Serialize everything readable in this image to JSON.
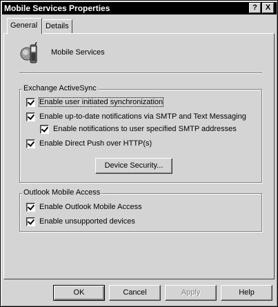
{
  "window": {
    "title": "Mobile Services Properties"
  },
  "titlebar_buttons": {
    "help": "?",
    "close": "X"
  },
  "tabs": [
    {
      "label": "General",
      "active": true
    },
    {
      "label": "Details",
      "active": false
    }
  ],
  "header": {
    "icon": "mobile-phone-icon",
    "title": "Mobile Services"
  },
  "activesync": {
    "label": "Exchange ActiveSync",
    "options": [
      {
        "label": "Enable user initiated synchronization",
        "checked": true
      },
      {
        "label": "Enable up-to-date notifications via SMTP and Text Messaging",
        "checked": true
      },
      {
        "label": "Enable notifications to user specified SMTP addresses",
        "checked": true
      },
      {
        "label": "Enable Direct Push over HTTP(s)",
        "checked": true
      }
    ],
    "device_security_button": "Device Security..."
  },
  "oma": {
    "label": "Outlook Mobile Access",
    "options": [
      {
        "label": "Enable Outlook Mobile Access",
        "checked": true
      },
      {
        "label": "Enable unsupported devices",
        "checked": true
      }
    ]
  },
  "footer": {
    "ok": "OK",
    "cancel": "Cancel",
    "apply": "Apply",
    "help": "Help"
  }
}
